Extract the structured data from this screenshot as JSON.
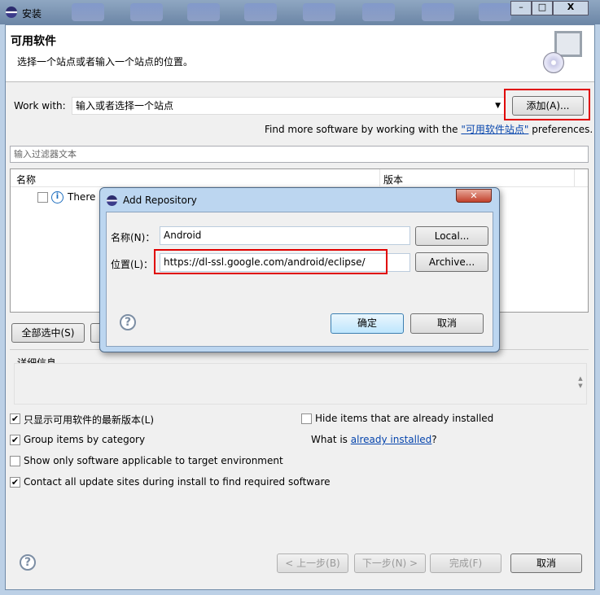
{
  "window": {
    "title": "安装",
    "controls": {
      "minimize": "–",
      "maximize": "□",
      "close": "X"
    }
  },
  "header": {
    "title": "可用软件",
    "subtitle": "选择一个站点或者输入一个站点的位置。"
  },
  "work_with": {
    "label": "Work with:",
    "value": "输入或者选择一个站点",
    "add_button": "添加(A)...",
    "find_more_prefix": "Find more software by working with the ",
    "find_more_link": "\"可用软件站点\"",
    "find_more_suffix": " preferences."
  },
  "filter": {
    "placeholder": "输入过滤器文本"
  },
  "table": {
    "columns": [
      "名称",
      "版本"
    ],
    "rows": [
      {
        "name": "There is",
        "checked": false
      }
    ]
  },
  "buttons": {
    "select_all": "全部选中(S)"
  },
  "details": {
    "label": "详细信息"
  },
  "options": {
    "show_latest": {
      "label": "只显示可用软件的最新版本(L)",
      "checked": true
    },
    "hide_installed": {
      "label": "Hide items that are already installed",
      "checked": false
    },
    "group_by_category": {
      "label": "Group items by category",
      "checked": true
    },
    "what_is_prefix": "What is ",
    "what_is_link": "already installed",
    "what_is_suffix": "?",
    "show_applicable": {
      "label": "Show only software applicable to target environment",
      "checked": false
    },
    "contact_all": {
      "label": "Contact all update sites during install to find required software",
      "checked": true
    }
  },
  "footer": {
    "back": "< 上一步(B)",
    "next": "下一步(N) >",
    "finish": "完成(F)",
    "cancel": "取消"
  },
  "dialog": {
    "title": "Add Repository",
    "name_label": "名称(N)：",
    "name_value": "Android",
    "location_label": "位置(L)：",
    "location_value": "https://dl-ssl.google.com/android/eclipse/",
    "local_button": "Local...",
    "archive_button": "Archive...",
    "ok_button": "确定",
    "cancel_button": "取消"
  },
  "colors": {
    "highlight": "#e00000",
    "link": "#0645ad"
  }
}
